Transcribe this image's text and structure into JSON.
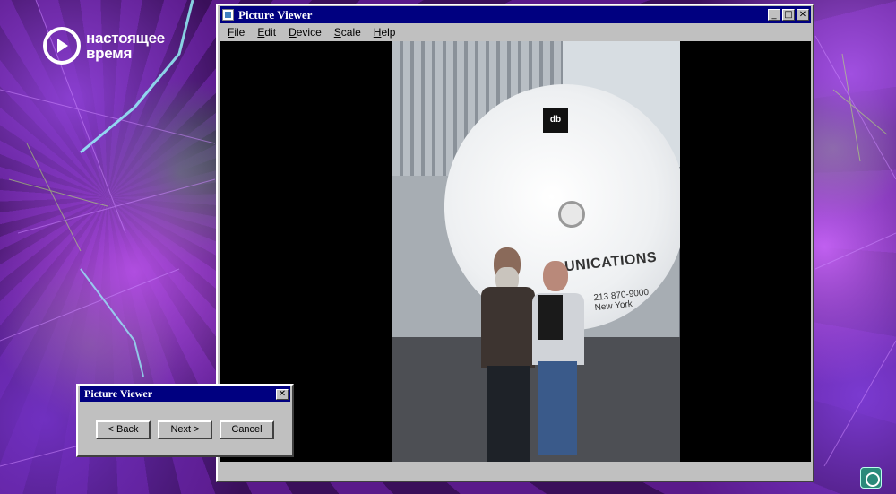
{
  "branding": {
    "logo_line1": "настоящее",
    "logo_line2": "время"
  },
  "main_window": {
    "title": "Picture Viewer",
    "menu": [
      {
        "label": "File",
        "key": "F"
      },
      {
        "label": "Edit",
        "key": "E"
      },
      {
        "label": "Device",
        "key": "D"
      },
      {
        "label": "Scale",
        "key": "S"
      },
      {
        "label": "Help",
        "key": "H"
      }
    ],
    "title_buttons": {
      "minimize": "_",
      "maximize": "□",
      "close": "✕"
    }
  },
  "photo": {
    "dish_logo": "db",
    "dish_text": "UNICATIONS",
    "dish_phone": "213 870-9000",
    "dish_city": "New York"
  },
  "dialog": {
    "title": "Picture Viewer",
    "close_glyph": "✕",
    "buttons": {
      "back": "< Back",
      "next": "Next >",
      "cancel": "Cancel"
    }
  },
  "colors": {
    "titlebar": "#000080",
    "window_face": "#c0c0c0",
    "canvas": "#000000"
  }
}
